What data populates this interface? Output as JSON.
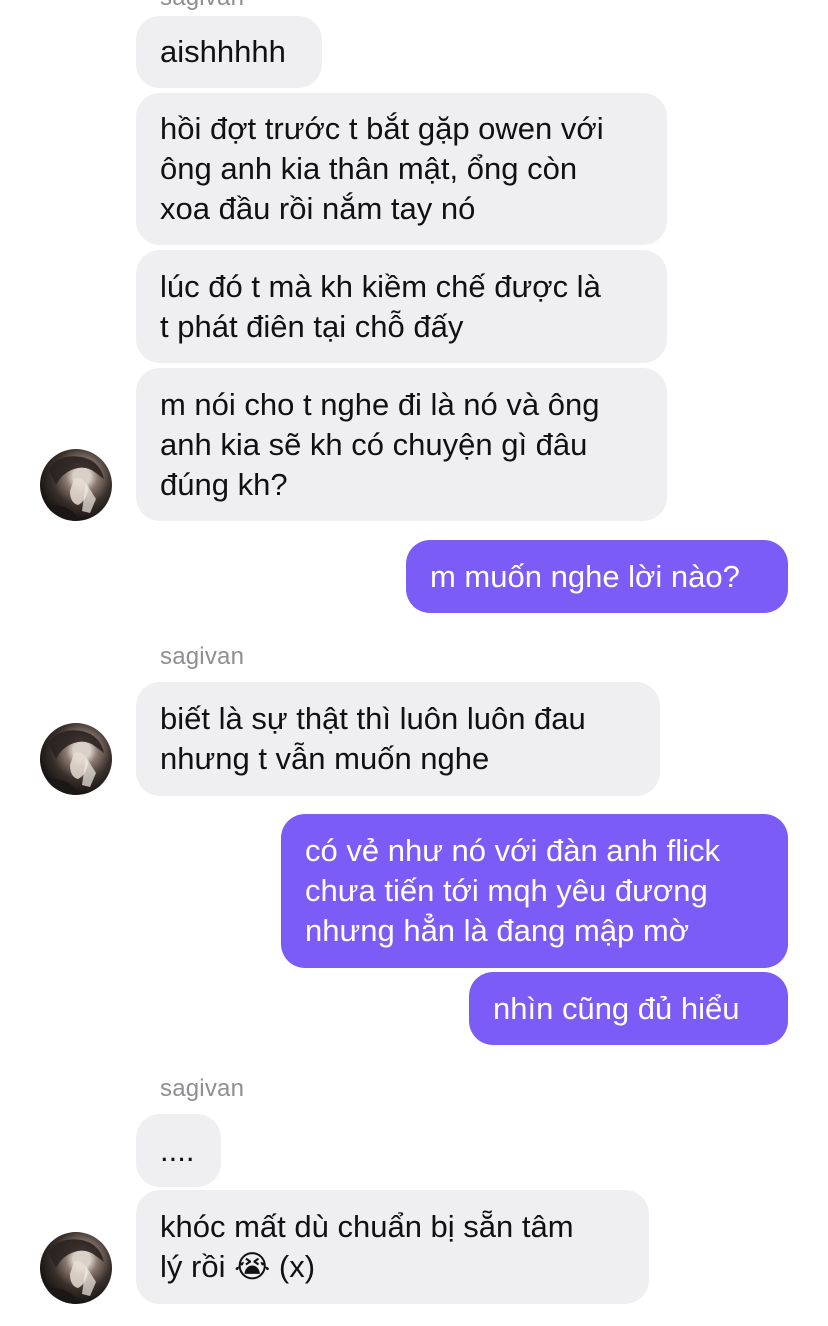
{
  "chat": {
    "contact_name": "sagivan",
    "messages": [
      {
        "from": "them",
        "text": "aishhhhh"
      },
      {
        "from": "them",
        "text": "hồi đợt trước t bắt gặp owen với\nông anh kia thân mật, ổng còn\nxoa đầu rồi nắm tay nó"
      },
      {
        "from": "them",
        "text": "lúc đó t mà kh kiềm chế được là\nt phát điên tại chỗ đấy"
      },
      {
        "from": "them",
        "text": "m nói cho t nghe đi là nó và ông\nanh kia sẽ kh có chuyện gì đâu\nđúng kh?"
      },
      {
        "from": "me",
        "text": "m muốn nghe lời nào?"
      },
      {
        "from": "them",
        "text": "biết là sự thật thì luôn luôn đau\nnhưng t vẫn muốn nghe"
      },
      {
        "from": "me",
        "text": "có vẻ như nó với đàn anh flick\nchưa tiến tới mqh yêu đương\nnhưng hẳn là đang mập mờ"
      },
      {
        "from": "me",
        "text": "nhìn cũng đủ hiểu"
      },
      {
        "from": "them",
        "text": "...."
      },
      {
        "from": "them",
        "text": "khóc mất dù chuẩn bị sẵn tâm\nlý rồi 😭 (x)"
      }
    ]
  },
  "colors": {
    "incoming_bubble": "#efeff2",
    "outgoing_bubble": "#7b5cf7",
    "sender_name": "#8e8e93"
  },
  "icons": {
    "avatar": "contact-avatar-photo"
  }
}
